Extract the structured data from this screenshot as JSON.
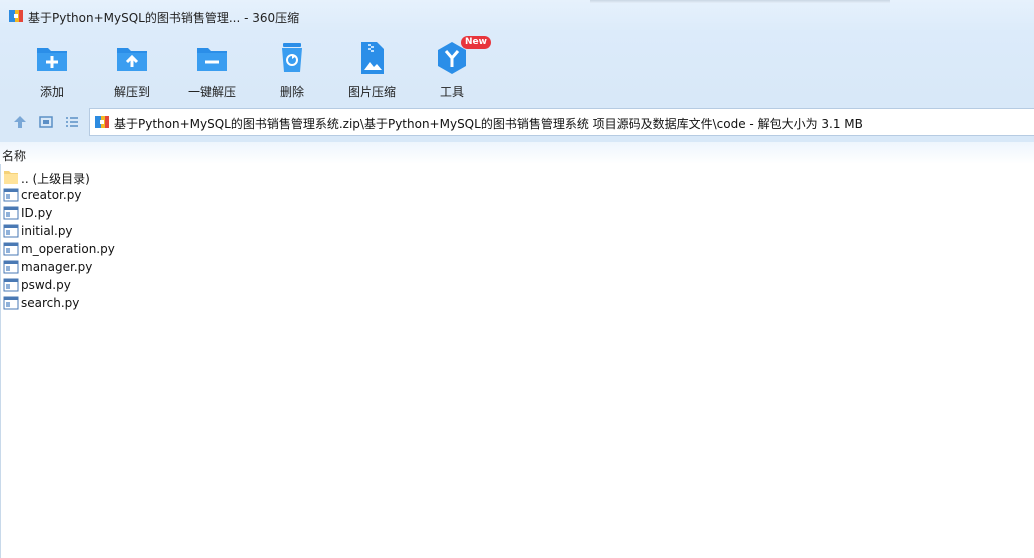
{
  "window": {
    "title": "基于Python+MySQL的图书销售管理... - 360压缩"
  },
  "toolbar": {
    "items": [
      {
        "label": "添加",
        "icon": "add-folder-icon"
      },
      {
        "label": "解压到",
        "icon": "extract-to-icon"
      },
      {
        "label": "一键解压",
        "icon": "one-click-extract-icon"
      },
      {
        "label": "删除",
        "icon": "recycle-bin-icon"
      },
      {
        "label": "图片压缩",
        "icon": "image-compress-icon"
      },
      {
        "label": "工具",
        "icon": "tools-icon",
        "badge": "New"
      }
    ]
  },
  "address": {
    "path": "基于Python+MySQL的图书销售管理系统.zip\\基于Python+MySQL的图书销售管理系统 项目源码及数据库文件\\code - 解包大小为 3.1 MB"
  },
  "columns": {
    "name": "名称"
  },
  "files": [
    {
      "name": ".. (上级目录)",
      "type": "folder"
    },
    {
      "name": "creator.py",
      "type": "file"
    },
    {
      "name": "ID.py",
      "type": "file"
    },
    {
      "name": "initial.py",
      "type": "file"
    },
    {
      "name": "m_operation.py",
      "type": "file"
    },
    {
      "name": "manager.py",
      "type": "file"
    },
    {
      "name": "pswd.py",
      "type": "file"
    },
    {
      "name": "search.py",
      "type": "file"
    }
  ],
  "colors": {
    "accent": "#2b8ee8",
    "badge": "#e8353c",
    "chrome": "#dcebfa"
  }
}
